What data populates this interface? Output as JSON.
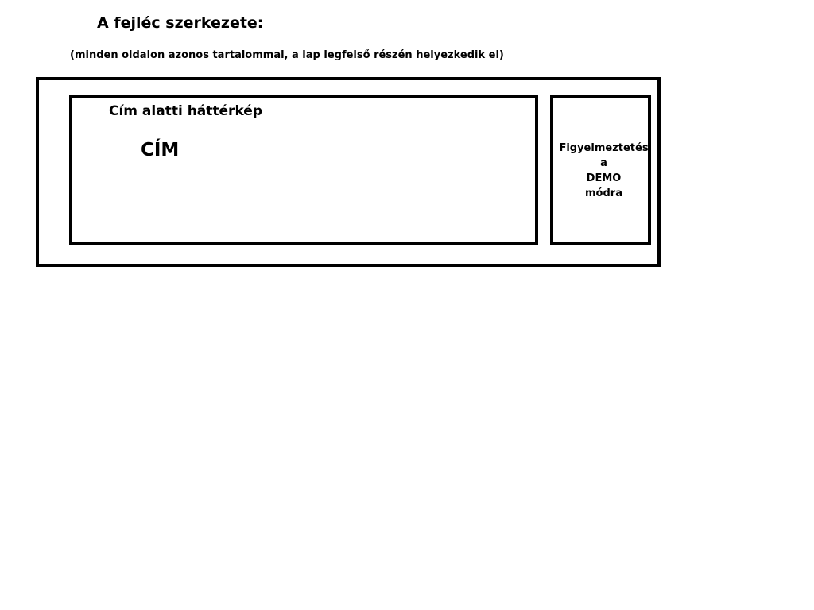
{
  "heading": {
    "title": "A fejléc szerkezete:",
    "subtitle": "(minden oldalon azonos tartalommal, a lap legfelső részén helyezkedik el)"
  },
  "header_layout": {
    "banner": {
      "label": "Cím alatti háttérkép",
      "title": "CÍM"
    },
    "warning": {
      "lines": [
        "Figyelmeztetés",
        "a",
        "DEMO",
        "módra"
      ]
    }
  }
}
